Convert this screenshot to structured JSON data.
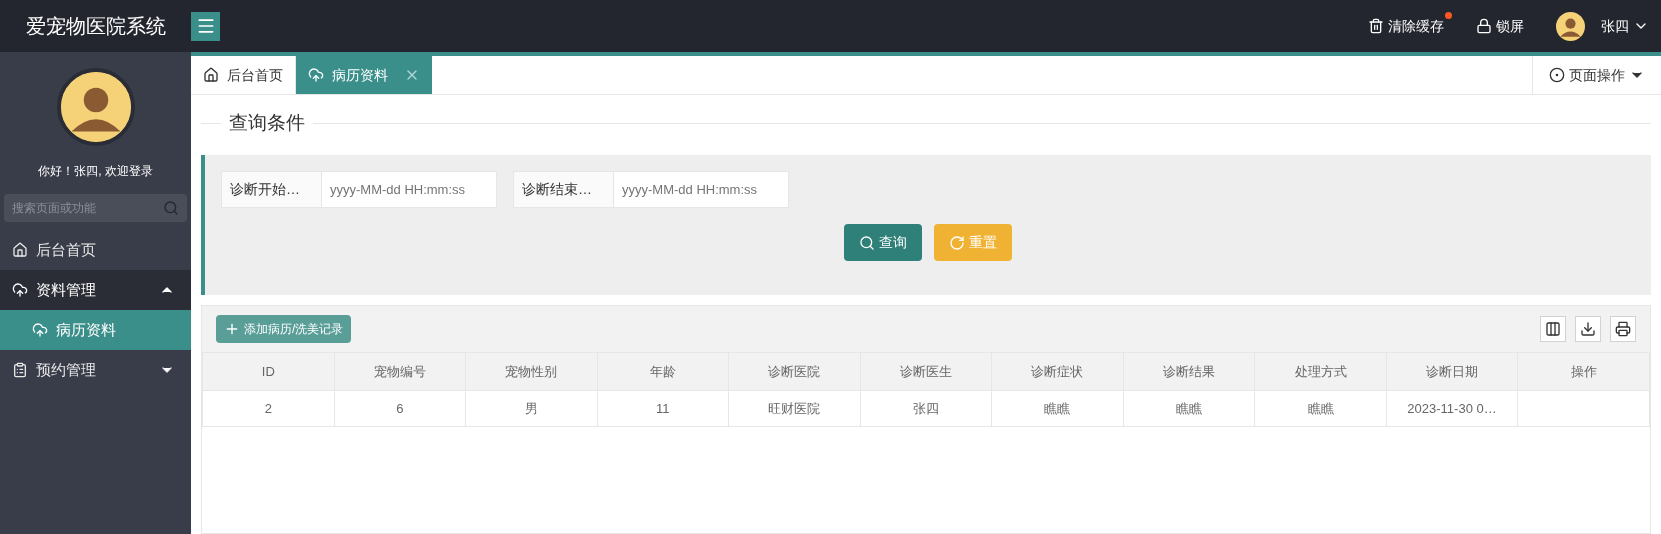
{
  "header": {
    "title": "爱宠物医院系统",
    "actions": [
      {
        "kind": "trash",
        "label": "清除缓存",
        "badge": true
      },
      {
        "kind": "lock",
        "label": "锁屏",
        "badge": false
      }
    ],
    "user": {
      "name": "张四"
    }
  },
  "sidebar": {
    "greeting": "你好！张四, 欢迎登录",
    "search": {
      "placeholder": "搜索页面或功能"
    },
    "items": [
      {
        "kind": "home",
        "label": "后台首页",
        "selected": false
      },
      {
        "kind": "cloud",
        "label": "资料管理",
        "selected": false,
        "expanded": true,
        "children": [
          {
            "kind": "cloud",
            "label": "病历资料",
            "selected": true
          }
        ]
      },
      {
        "kind": "clipboard",
        "label": "预约管理",
        "selected": false,
        "expanded": false
      }
    ]
  },
  "tabs": [
    {
      "kind": "home",
      "label": "后台首页",
      "selected": false,
      "closable": false
    },
    {
      "kind": "cloud",
      "label": "病历资料",
      "selected": true,
      "closable": true
    }
  ],
  "page_menu": "页面操作",
  "query": {
    "legend": "查询条件",
    "fields": [
      {
        "label": "诊断开始…",
        "placeholder": "yyyy-MM-dd HH:mm:ss"
      },
      {
        "label": "诊断结束…",
        "placeholder": "yyyy-MM-dd HH:mm:ss"
      }
    ],
    "buttons": [
      {
        "kind": "search",
        "label": "查询"
      },
      {
        "kind": "reset",
        "label": "重置"
      }
    ]
  },
  "toolbar": {
    "add_button": "添加病历/洗美记录"
  },
  "table": {
    "columns": [
      "ID",
      "宠物编号",
      "宠物性别",
      "年龄",
      "诊断医院",
      "诊断医生",
      "诊断症状",
      "诊断结果",
      "处理方式",
      "诊断日期",
      "操作"
    ],
    "rows": [
      [
        "2",
        "6",
        "男",
        "11",
        "旺财医院",
        "张四",
        "瞧瞧",
        "瞧瞧",
        "瞧瞧",
        "2023-11-30 0…",
        ""
      ]
    ]
  }
}
